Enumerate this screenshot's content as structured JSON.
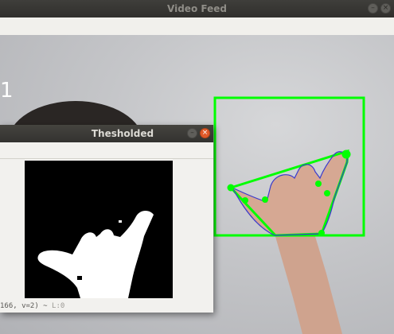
{
  "main_window": {
    "title": "Video Feed",
    "frame_counter": "1"
  },
  "threshold_window": {
    "title": "Thesholded",
    "status_text": "166, v=2) ~",
    "status_level": "L:0"
  },
  "colors": {
    "detection_box": "#00ff00",
    "contour": "#3a3acc",
    "titlebar_dark": "#333230",
    "close_button": "#e05a2a"
  },
  "icons": {
    "minimize": "minimize-icon",
    "close": "close-icon"
  }
}
